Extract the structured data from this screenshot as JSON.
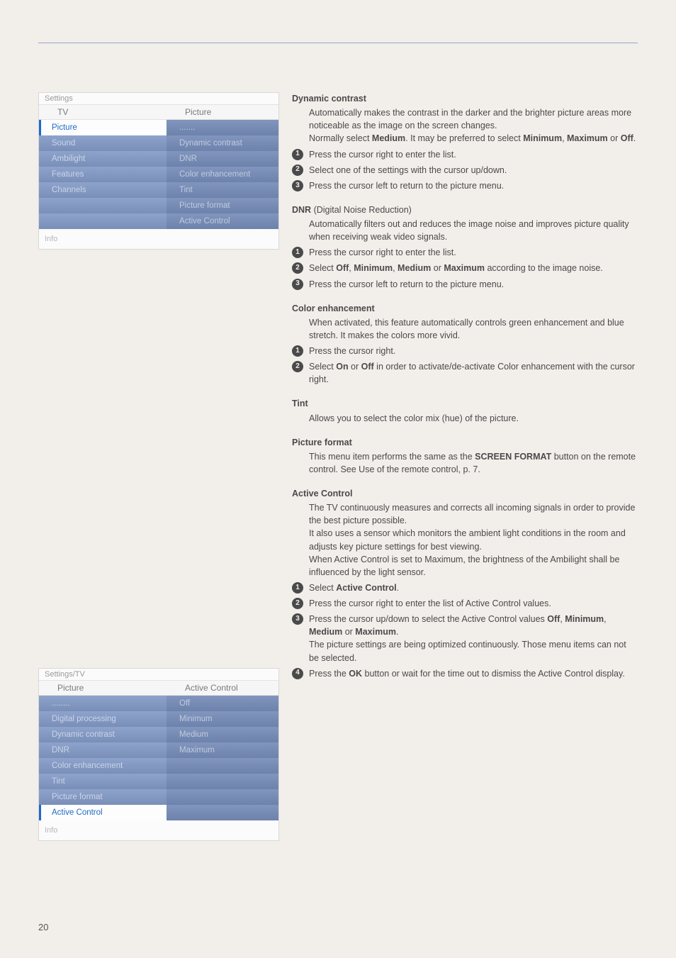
{
  "page_number": "20",
  "screenshot1": {
    "header": "Settings",
    "col1_header": "TV",
    "col2_header": "Picture",
    "left_items": [
      "Picture",
      "Sound",
      "Ambilight",
      "Features",
      "Channels"
    ],
    "right_items": [
      ".......",
      "Dynamic contrast",
      "DNR",
      "Color enhancement",
      "Tint",
      "Picture format",
      "Active Control"
    ],
    "info": "Info"
  },
  "screenshot2": {
    "header": "Settings/TV",
    "col1_header": "Picture",
    "col2_header": "Active Control",
    "left_items": [
      "........",
      "Digital processing",
      "Dynamic contrast",
      "DNR",
      "Color enhancement",
      "Tint",
      "Picture format",
      "Active Control"
    ],
    "right_items": [
      "Off",
      "Minimum",
      "Medium",
      "Maximum"
    ],
    "info": "Info"
  },
  "sections": {
    "dc": {
      "title": "Dynamic contrast",
      "p1a": "Automatically makes the contrast in the darker and the brighter picture areas more noticeable as the image on the screen changes.",
      "p1b_pre": "Normally select ",
      "p1b_b1": "Medium",
      "p1b_mid": ". It may be preferred to select ",
      "p1b_b2": "Minimum",
      "p1b_sep": ", ",
      "p1b_b3": "Maximum",
      "p1b_or": " or ",
      "p1b_b4": "Off",
      "p1b_end": ".",
      "s1": "Press the cursor right to enter the list.",
      "s2": "Select one of the settings with the cursor up/down.",
      "s3": "Press the cursor left to return to the picture menu."
    },
    "dnr": {
      "title": "DNR",
      "title_suffix": " (Digital Noise Reduction)",
      "p1": "Automatically filters out and reduces the image noise and improves picture quality when receiving weak video signals.",
      "s1": "Press the cursor right to enter the list.",
      "s2_pre": "Select ",
      "s2_b1": "Off",
      "s2_c1": ", ",
      "s2_b2": "Minimum",
      "s2_c2": ", ",
      "s2_b3": "Medium",
      "s2_or": " or ",
      "s2_b4": "Maximum",
      "s2_end": " according to the image noise.",
      "s3": "Press the cursor left to return to the picture menu."
    },
    "ce": {
      "title": "Color enhancement",
      "p1": "When activated, this feature automatically controls green enhancement and blue stretch. It makes the colors more vivid.",
      "s1": "Press the cursor right.",
      "s2_pre": "Select ",
      "s2_b1": "On",
      "s2_or": " or ",
      "s2_b2": "Off",
      "s2_end": " in order to activate/de-activate Color enhancement with the cursor right."
    },
    "tint": {
      "title": "Tint",
      "p1": "Allows you to select the color mix (hue) of the picture."
    },
    "pf": {
      "title": "Picture format",
      "p1_pre": "This menu item performs the same as the ",
      "p1_b": "SCREEN FORMAT",
      "p1_end": " button on the remote control. See Use of the remote control, p. 7."
    },
    "ac": {
      "title": "Active Control",
      "p1": "The TV continuously measures and corrects all incoming signals in order to provide the best picture possible.",
      "p2": "It also uses a sensor which monitors the ambient light conditions in the room and adjusts key picture settings for best viewing.",
      "p3": "When Active Control is set to Maximum, the brightness of the Ambilight shall be influenced by the light sensor.",
      "s1_pre": "Select ",
      "s1_b": "Active Control",
      "s1_end": ".",
      "s2": "Press the cursor right to enter the list of Active Control values.",
      "s3_pre": "Press the cursor up/down to select the Active Control values ",
      "s3_b1": "Off",
      "s3_c1": ", ",
      "s3_b2": "Minimum",
      "s3_c2": ", ",
      "s3_b3": "Medium",
      "s3_or": " or ",
      "s3_b4": "Maximum",
      "s3_end": ".",
      "s3_note": "The picture settings are being optimized continuously. Those menu items can not be selected.",
      "s4_pre": "Press the ",
      "s4_b": "OK",
      "s4_end": " button or wait for the time out to dismiss the Active Control display."
    }
  }
}
